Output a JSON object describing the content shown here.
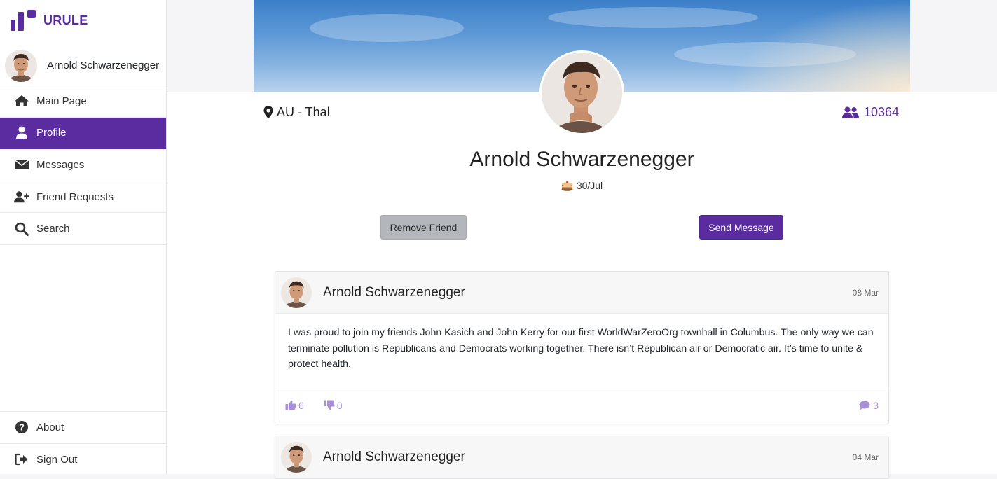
{
  "app": {
    "brand": "URULE",
    "accent": "#5a2ca0"
  },
  "sidebar": {
    "user_name": "Arnold Schwarzenegger",
    "items": [
      {
        "label": "Main Page",
        "icon": "home-icon"
      },
      {
        "label": "Profile",
        "icon": "user-icon",
        "active": true
      },
      {
        "label": "Messages",
        "icon": "envelope-icon"
      },
      {
        "label": "Friend Requests",
        "icon": "user-plus-icon"
      },
      {
        "label": "Search",
        "icon": "search-icon"
      }
    ],
    "bottom_items": [
      {
        "label": "About",
        "icon": "question-circle-icon"
      },
      {
        "label": "Sign Out",
        "icon": "sign-out-icon"
      }
    ]
  },
  "profile": {
    "name": "Arnold Schwarzenegger",
    "location": "AU - Thal",
    "friends_count": "10364",
    "birthday": "30/Jul",
    "remove_friend_label": "Remove Friend",
    "send_message_label": "Send Message"
  },
  "posts": [
    {
      "author": "Arnold Schwarzenegger",
      "date": "08 Mar",
      "text": "I was proud to join my friends John Kasich and John Kerry for our first WorldWarZeroOrg townhall in Columbus. The only way we can terminate pollution is Republicans and Democrats working together. There isn’t Republican air or Democratic air. It’s time to unite & protect health.",
      "likes": "6",
      "dislikes": "0",
      "comments": "3"
    },
    {
      "author": "Arnold Schwarzenegger",
      "date": "04 Mar"
    }
  ]
}
